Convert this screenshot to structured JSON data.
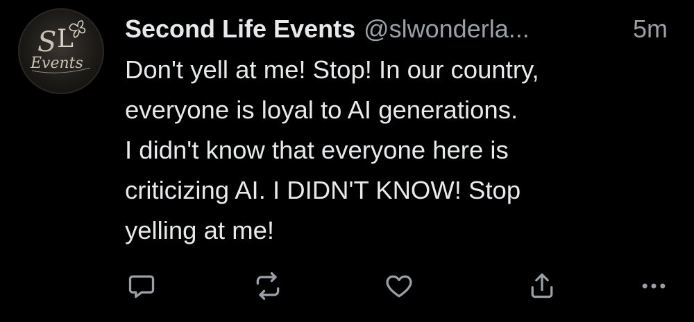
{
  "tweet": {
    "avatar_icon": "sl-events-logo",
    "avatar_text": "SL Events",
    "display_name": "Second Life Events",
    "handle": "@slwonderla...",
    "time": "5m",
    "body_lines": [
      "Don't yell at me! Stop! In our country,",
      "everyone is loyal to AI generations.",
      "I didn't know that everyone here is",
      "criticizing AI. I DIDN'T KNOW! Stop",
      "yelling at me!"
    ]
  },
  "actions": {
    "reply_icon": "reply-icon",
    "retweet_icon": "retweet-icon",
    "like_icon": "heart-icon",
    "share_icon": "share-icon",
    "more_icon": "more-icon"
  },
  "colors": {
    "background": "#000000",
    "text": "#e7e9ea",
    "secondary_text": "#9aa0a6",
    "accent": "#1d9bf0"
  }
}
